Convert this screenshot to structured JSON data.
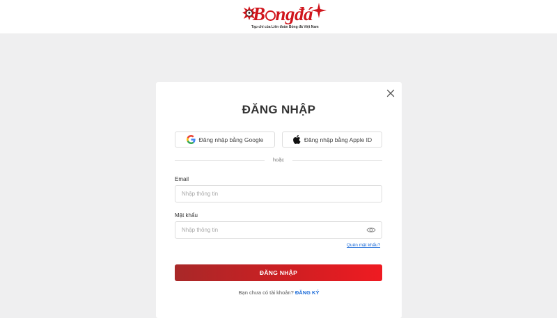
{
  "header": {
    "logo_text": "Bóngđá",
    "logo_word_1": "B",
    "logo_word_2": "ngđá",
    "tagline": "Tạp chí của Liên đoàn Bóng đá Việt Nam"
  },
  "modal": {
    "title": "ĐĂNG NHẬP",
    "google_label": "Đăng nhập bằng Google",
    "apple_label": "Đăng nhập bằng Apple ID",
    "divider": "hoặc",
    "email_label": "Email",
    "email_placeholder": "Nhập thông tin",
    "email_value": "",
    "password_label": "Mật khẩu",
    "password_placeholder": "Nhập thông tin",
    "password_value": "",
    "forgot_label": "Quên mật khẩu?",
    "submit_label": "ĐĂNG NHẬP",
    "signup_prompt": "Bạn chưa có tài khoản?",
    "signup_label": "ĐĂNG KÝ"
  },
  "icons": {
    "close": "close-icon",
    "google": "google-icon",
    "apple": "apple-icon",
    "eye": "eye-icon",
    "logo_ball": "football-splash-icon",
    "logo_star": "star-icon"
  },
  "colors": {
    "brand_red": "#d0151c",
    "button_gradient_start": "#a82828",
    "button_gradient_end": "#ef1b22",
    "link_blue": "#1a6ad8",
    "page_bg": "#efeff0"
  }
}
